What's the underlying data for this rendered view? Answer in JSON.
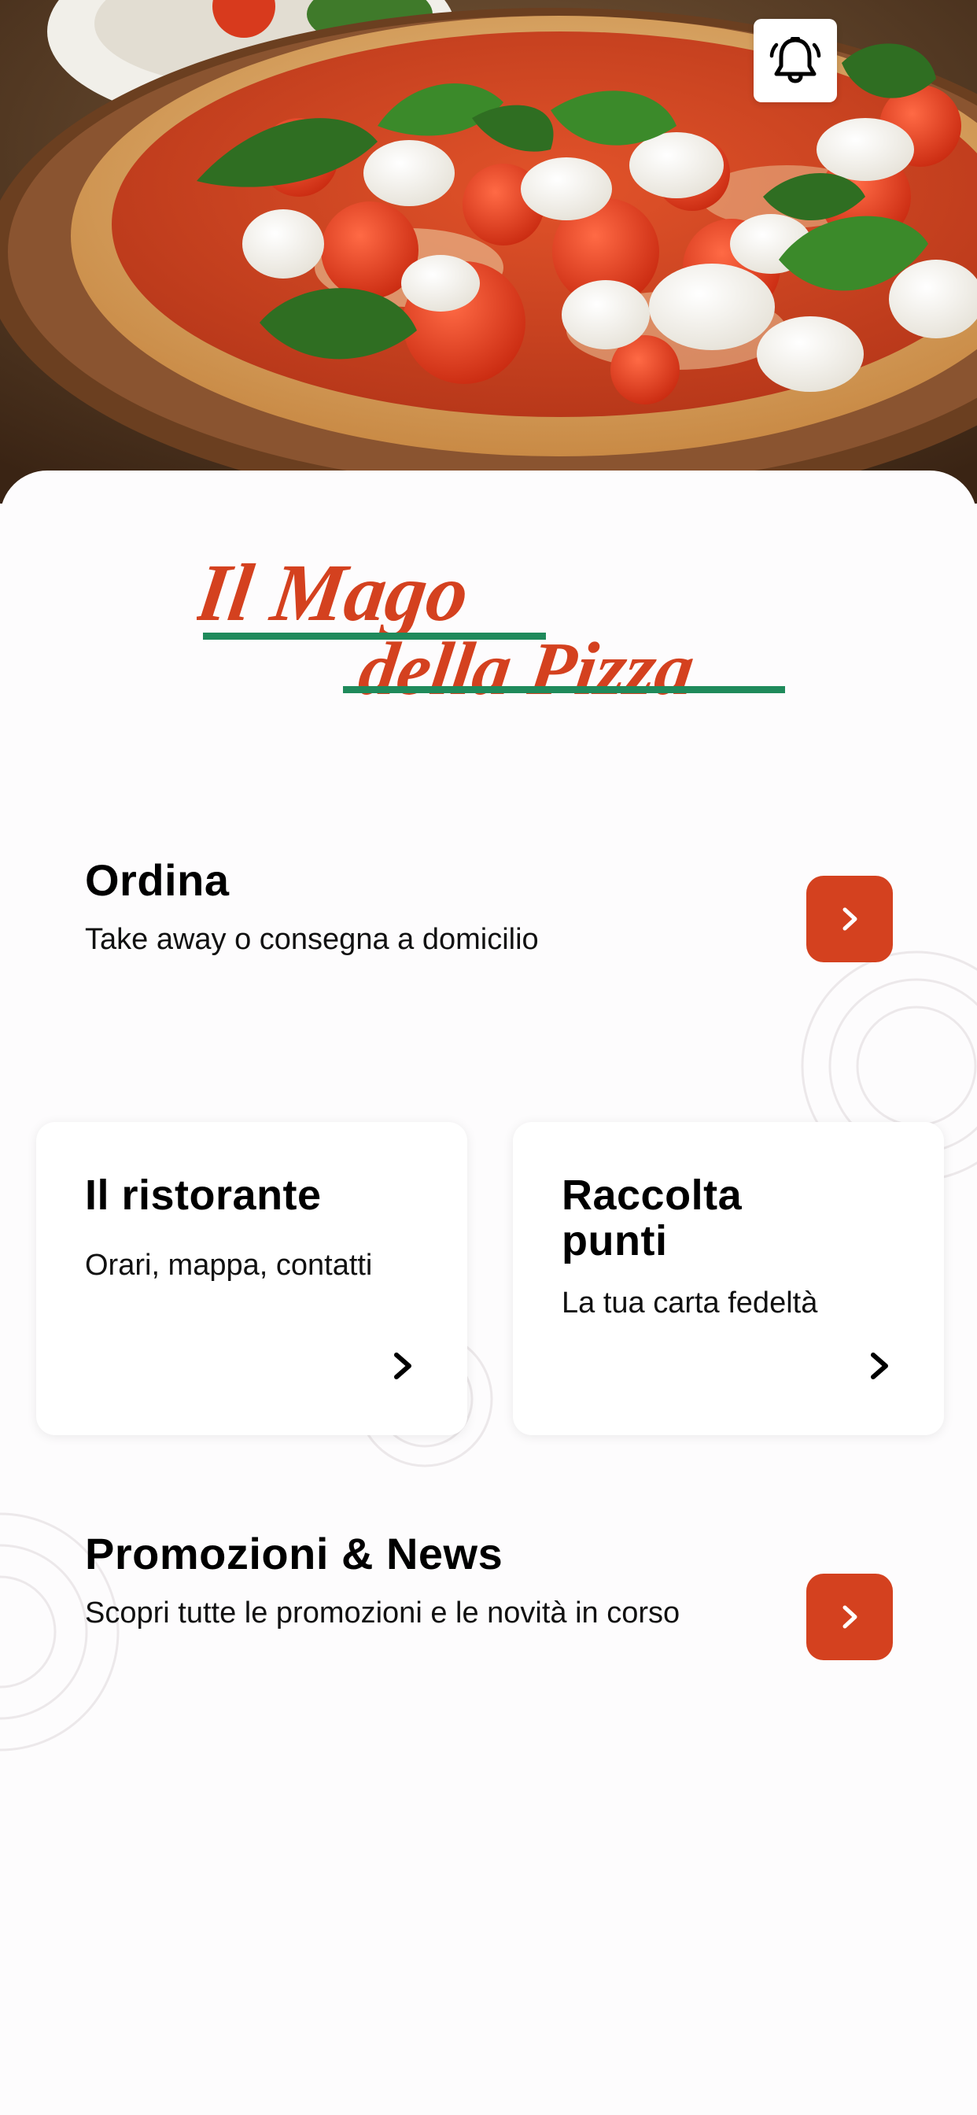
{
  "header": {
    "notifications_icon": "bell-icon"
  },
  "brand": {
    "logo_line1": "Il Mago",
    "logo_line2": "della Pizza",
    "logo_red": "#d4411f",
    "logo_green": "#1f8a5b"
  },
  "sections": {
    "order": {
      "title": "Ordina",
      "subtitle": "Take away o consegna a domicilio",
      "action_icon": "chevron-right-icon"
    },
    "restaurant": {
      "title": "Il ristorante",
      "subtitle": "Orari, mappa, contatti",
      "action_icon": "chevron-right-icon"
    },
    "loyalty": {
      "title": "Raccolta punti",
      "subtitle": "La tua carta fedeltà",
      "action_icon": "chevron-right-icon"
    },
    "promotions": {
      "title": "Promozioni & News",
      "subtitle": "Scopri tutte le promozioni e le novità in corso",
      "action_icon": "chevron-right-icon"
    }
  },
  "colors": {
    "accent": "#d4411f",
    "background": "#fdfcfd",
    "card": "#ffffff",
    "text": "#000000"
  }
}
